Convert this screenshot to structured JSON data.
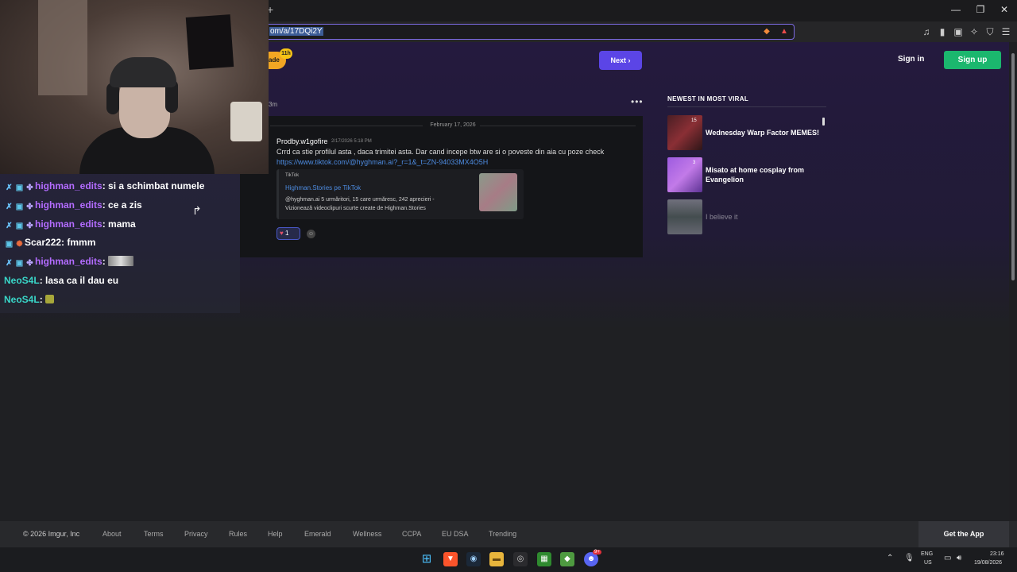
{
  "browser": {
    "new_tab_symbol": "+",
    "url_fragment": "om/a/17DQi2Y",
    "window_controls": [
      "—",
      "❐",
      "✕"
    ]
  },
  "header": {
    "logo_fragment": "ade",
    "logo_badge": "11h",
    "next_label": "Next",
    "sign_in": "Sign in",
    "sign_up": "Sign up"
  },
  "post": {
    "time_fragment": "3m",
    "menu_symbol": "•••"
  },
  "comment": {
    "date_separator": "February 17, 2026",
    "author": "Prodby.w1gofire",
    "timestamp": "2/17/2026 5:18 PM",
    "body": "Crrd ca stie profilul asta , daca trimitei asta.  Dar cand incepe  btw are si o poveste din aia cu poze check",
    "link": "https://www.tiktok.com/@hyghman.ai?_r=1&_t=ZN-94033MX4O5H",
    "embed": {
      "provider": "TikTok",
      "title": "Highman.Stories pe TikTok",
      "desc_line1": "@hyghman.ai 5 urmăritori, 15 care urmăresc, 242 aprecieri -",
      "desc_line2": "Vizionează videoclipuri scurte create de Highman.Stories"
    },
    "reaction_count": "1"
  },
  "sidebar": {
    "title": "NEWEST IN MOST VIRAL",
    "items": [
      {
        "label": "Wednesday Warp Factor MEMES!",
        "thumb_badge": "15"
      },
      {
        "label": "Misato at home cosplay from Evangelion",
        "thumb_badge": "3"
      },
      {
        "label": "I believe it"
      }
    ]
  },
  "footer": {
    "copyright": "© 2026 Imgur, Inc",
    "links": [
      "About",
      "Terms",
      "Privacy",
      "Rules",
      "Help",
      "Emerald",
      "Wellness",
      "CCPA",
      "EU DSA",
      "Trending"
    ],
    "get_app": "Get the App"
  },
  "chat": {
    "messages": [
      {
        "user": "highman_edits",
        "text": "si a schimbat numele"
      },
      {
        "user": "highman_edits",
        "text": "ce a zis"
      },
      {
        "user": "highman_edits",
        "text": "mama"
      },
      {
        "user": "Scar222",
        "text": "fmmm"
      },
      {
        "user": "highman_edits",
        "text": ""
      },
      {
        "user": "NeoS4L",
        "text": "lasa ca il dau eu"
      },
      {
        "user": "NeoS4L",
        "text": ""
      }
    ]
  },
  "taskbar": {
    "discord_badge": "9+",
    "lang_line1": "ENG",
    "lang_line2": "US",
    "time": "23:16",
    "date": "19/08/2026"
  },
  "colors": {
    "accent_next": "#5b45e6",
    "sign_up_green": "#1bb76e",
    "link_blue": "#4d8be0",
    "chat_purple": "#b36cff",
    "chat_cyan": "#39d6c8"
  }
}
